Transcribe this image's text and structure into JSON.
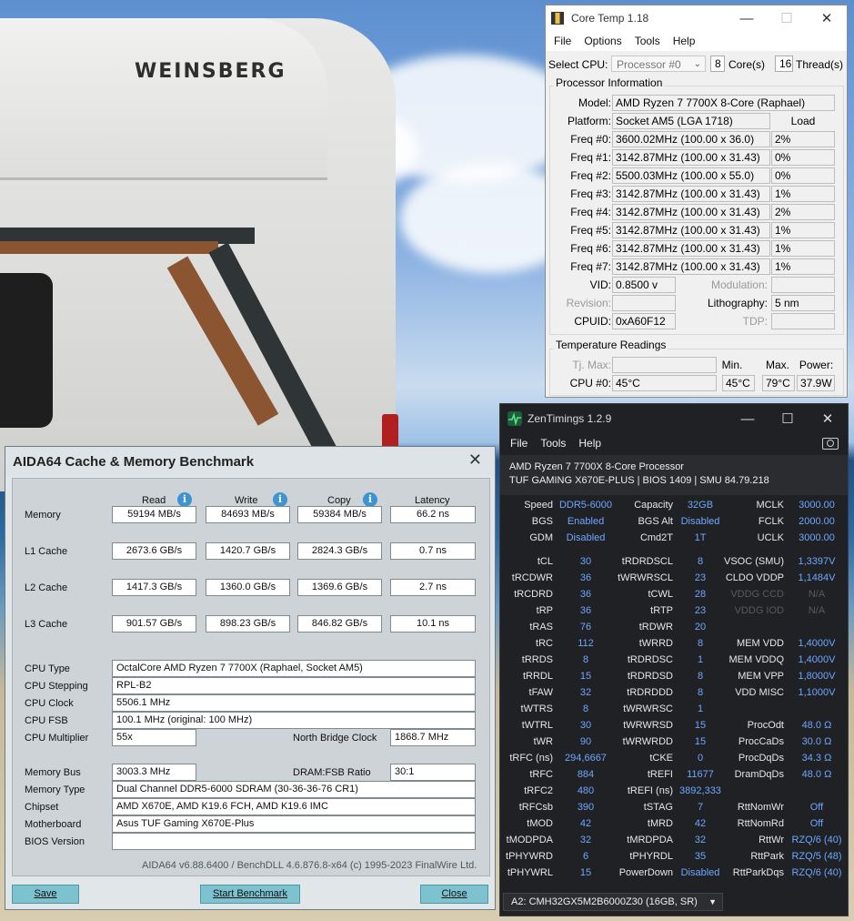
{
  "wallpaper": {
    "brand": "WEINSBERG"
  },
  "coretemp": {
    "title": "Core Temp 1.18",
    "menu": [
      "File",
      "Options",
      "Tools",
      "Help"
    ],
    "select_cpu_label": "Select CPU:",
    "processor": "Processor #0",
    "cores": "8",
    "cores_label": "Core(s)",
    "threads": "16",
    "threads_label": "Thread(s)",
    "proc_info_title": "Processor Information",
    "model_label": "Model:",
    "model": "AMD Ryzen 7 7700X 8-Core (Raphael)",
    "platform_label": "Platform:",
    "platform": "Socket AM5 (LGA 1718)",
    "load_label": "Load",
    "freqs": [
      {
        "label": "Freq #0:",
        "value": "3600.02MHz (100.00 x 36.0)",
        "load": "2%"
      },
      {
        "label": "Freq #1:",
        "value": "3142.87MHz (100.00 x 31.43)",
        "load": "0%"
      },
      {
        "label": "Freq #2:",
        "value": "5500.03MHz (100.00 x 55.0)",
        "load": "0%"
      },
      {
        "label": "Freq #3:",
        "value": "3142.87MHz (100.00 x 31.43)",
        "load": "1%"
      },
      {
        "label": "Freq #4:",
        "value": "3142.87MHz (100.00 x 31.43)",
        "load": "2%"
      },
      {
        "label": "Freq #5:",
        "value": "3142.87MHz (100.00 x 31.43)",
        "load": "1%"
      },
      {
        "label": "Freq #6:",
        "value": "3142.87MHz (100.00 x 31.43)",
        "load": "1%"
      },
      {
        "label": "Freq #7:",
        "value": "3142.87MHz (100.00 x 31.43)",
        "load": "1%"
      }
    ],
    "vid_label": "VID:",
    "vid": "0.8500 v",
    "modulation_label": "Modulation:",
    "revision_label": "Revision:",
    "lithography_label": "Lithography:",
    "lithography": "5 nm",
    "cpuid_label": "CPUID:",
    "cpuid": "0xA60F12",
    "tdp_label": "TDP:",
    "temp_title": "Temperature Readings",
    "tjmax_label": "Tj. Max:",
    "min_label": "Min.",
    "max_label": "Max.",
    "power_label": "Power:",
    "cpu0_label": "CPU #0:",
    "cpu0_temp": "45°C",
    "cpu0_min": "45°C",
    "cpu0_max": "79°C",
    "cpu0_power": "37.9W"
  },
  "zentimings": {
    "title": "ZenTimings 1.2.9",
    "menu": [
      "File",
      "Tools",
      "Help"
    ],
    "cpu": "AMD Ryzen 7 7700X 8-Core Processor",
    "board": "TUF GAMING X670E-PLUS | BIOS 1409 | SMU 84.79.218",
    "top": [
      [
        "Speed",
        "DDR5-6000",
        "Capacity",
        "32GB",
        "MCLK",
        "3000.00"
      ],
      [
        "BGS",
        "Enabled",
        "BGS Alt",
        "Disabled",
        "FCLK",
        "2000.00"
      ],
      [
        "GDM",
        "Disabled",
        "Cmd2T",
        "1T",
        "UCLK",
        "3000.00"
      ]
    ],
    "timings": [
      [
        "tCL",
        "30",
        "tRDRDSCL",
        "8",
        "VSOC (SMU)",
        "1,3397V"
      ],
      [
        "tRCDWR",
        "36",
        "tWRWRSCL",
        "23",
        "CLDO VDDP",
        "1,1484V"
      ],
      [
        "tRCDRD",
        "36",
        "tCWL",
        "28",
        "VDDG CCD",
        "N/A"
      ],
      [
        "tRP",
        "36",
        "tRTP",
        "23",
        "VDDG IOD",
        "N/A"
      ],
      [
        "tRAS",
        "76",
        "tRDWR",
        "20",
        "",
        ""
      ],
      [
        "tRC",
        "112",
        "tWRRD",
        "8",
        "MEM VDD",
        "1,4000V"
      ],
      [
        "tRRDS",
        "8",
        "tRDRDSC",
        "1",
        "MEM VDDQ",
        "1,4000V"
      ],
      [
        "tRRDL",
        "15",
        "tRDRDSD",
        "8",
        "MEM VPP",
        "1,8000V"
      ],
      [
        "tFAW",
        "32",
        "tRDRDDD",
        "8",
        "VDD MISC",
        "1,1000V"
      ],
      [
        "tWTRS",
        "8",
        "tWRWRSC",
        "1",
        "",
        ""
      ],
      [
        "tWTRL",
        "30",
        "tWRWRSD",
        "15",
        "ProcOdt",
        "48.0 Ω"
      ],
      [
        "tWR",
        "90",
        "tWRWRDD",
        "15",
        "ProcCaDs",
        "30.0 Ω"
      ],
      [
        "tRFC (ns)",
        "294,6667",
        "tCKE",
        "0",
        "ProcDqDs",
        "34.3 Ω"
      ],
      [
        "tRFC",
        "884",
        "tREFI",
        "11677",
        "DramDqDs",
        "48.0 Ω"
      ],
      [
        "tRFC2",
        "480",
        "tREFI (ns)",
        "3892,333",
        "",
        ""
      ],
      [
        "tRFCsb",
        "390",
        "tSTAG",
        "7",
        "RttNomWr",
        "Off"
      ],
      [
        "tMOD",
        "42",
        "tMRD",
        "42",
        "RttNomRd",
        "Off"
      ],
      [
        "tMODPDA",
        "32",
        "tMRDPDA",
        "32",
        "RttWr",
        "RZQ/6 (40)"
      ],
      [
        "tPHYWRD",
        "6",
        "tPHYRDL",
        "35",
        "RttPark",
        "RZQ/5 (48)"
      ],
      [
        "tPHYWRL",
        "15",
        "PowerDown",
        "Disabled",
        "RttParkDqs",
        "RZQ/6 (40)"
      ]
    ],
    "module": "A2: CMH32GX5M2B6000Z30 (16GB, SR)"
  },
  "aida": {
    "title": "AIDA64 Cache & Memory Benchmark",
    "col_read": "Read",
    "col_write": "Write",
    "col_copy": "Copy",
    "col_latency": "Latency",
    "rows": [
      {
        "label": "Memory",
        "read": "59194 MB/s",
        "write": "84693 MB/s",
        "copy": "59384 MB/s",
        "latency": "66.2 ns"
      },
      {
        "label": "L1 Cache",
        "read": "2673.6 GB/s",
        "write": "1420.7 GB/s",
        "copy": "2824.3 GB/s",
        "latency": "0.7 ns"
      },
      {
        "label": "L2 Cache",
        "read": "1417.3 GB/s",
        "write": "1360.0 GB/s",
        "copy": "1369.6 GB/s",
        "latency": "2.7 ns"
      },
      {
        "label": "L3 Cache",
        "read": "901.57 GB/s",
        "write": "898.23 GB/s",
        "copy": "846.82 GB/s",
        "latency": "10.1 ns"
      }
    ],
    "cpu_type_label": "CPU Type",
    "cpu_type": "OctalCore AMD Ryzen 7 7700X  (Raphael, Socket AM5)",
    "cpu_stepping_label": "CPU Stepping",
    "cpu_stepping": "RPL-B2",
    "cpu_clock_label": "CPU Clock",
    "cpu_clock": "5506.1 MHz",
    "cpu_fsb_label": "CPU FSB",
    "cpu_fsb": "100.1 MHz  (original: 100 MHz)",
    "cpu_mult_label": "CPU Multiplier",
    "cpu_mult": "55x",
    "nb_clock_label": "North Bridge Clock",
    "nb_clock": "1868.7 MHz",
    "mem_bus_label": "Memory Bus",
    "mem_bus": "3003.3 MHz",
    "dram_fsb_label": "DRAM:FSB Ratio",
    "dram_fsb": "30:1",
    "mem_type_label": "Memory Type",
    "mem_type": "Dual Channel DDR5-6000 SDRAM  (30-36-36-76 CR1)",
    "chipset_label": "Chipset",
    "chipset": "AMD X670E, AMD K19.6 FCH, AMD K19.6 IMC",
    "motherboard_label": "Motherboard",
    "motherboard": "Asus TUF Gaming X670E-Plus",
    "bios_label": "BIOS Version",
    "bios": "",
    "footer": "AIDA64 v6.88.6400 / BenchDLL 4.6.876.8-x64  (c) 1995-2023 FinalWire Ltd.",
    "btn_save": "Save",
    "btn_start": "Start Benchmark",
    "btn_close": "Close"
  }
}
